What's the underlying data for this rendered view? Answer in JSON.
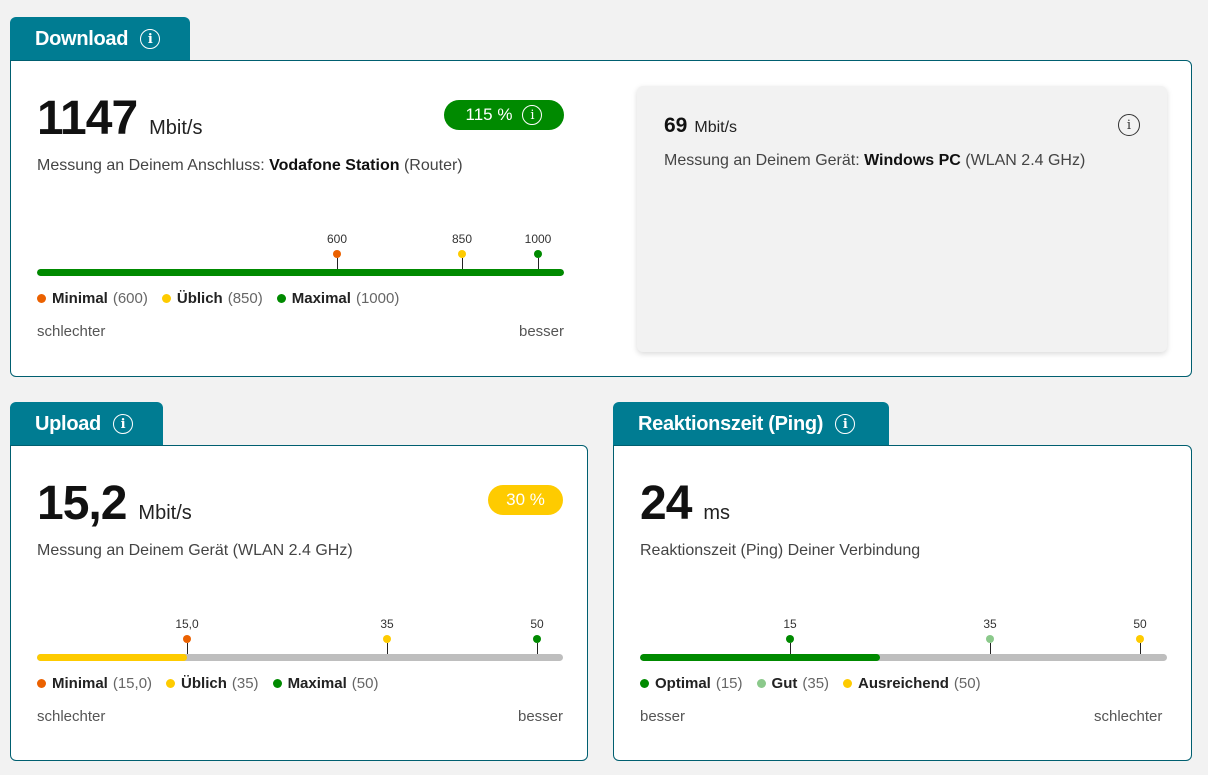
{
  "colors": {
    "orange": "#eb6100",
    "yellow": "#fecb00",
    "green": "#008a00",
    "lightgreen": "#8bc98b",
    "grey": "#bebebe",
    "teal": "#007c92"
  },
  "info_glyph": "i",
  "download": {
    "tab_label": "Download",
    "value": "1147",
    "unit": "Mbit/s",
    "badge": "115 %",
    "description_prefix": "Messung an Deinem Anschluss: ",
    "description_bold": "Vodafone Station",
    "description_suffix": " (Router)",
    "fill_fraction": 1.0,
    "ticks": [
      {
        "label": "600"
      },
      {
        "label": "850"
      },
      {
        "label": "1000"
      }
    ],
    "legend": [
      {
        "name": "Minimal",
        "value": "(600)"
      },
      {
        "name": "Üblich",
        "value": "(850)"
      },
      {
        "name": "Maximal",
        "value": "(1000)"
      }
    ],
    "scale_left": "schlechter",
    "scale_right": "besser",
    "device": {
      "value": "69",
      "unit": "Mbit/s",
      "description_prefix": "Messung an Deinem Gerät: ",
      "description_bold": "Windows PC",
      "description_suffix": " (WLAN 2.4 GHz)"
    }
  },
  "upload": {
    "tab_label": "Upload",
    "value": "15,2",
    "unit": "Mbit/s",
    "badge": "30 %",
    "description": "Messung an Deinem Gerät (WLAN 2.4 GHz)",
    "fill_fraction": 0.285,
    "ticks": [
      {
        "label": "15,0"
      },
      {
        "label": "35"
      },
      {
        "label": "50"
      }
    ],
    "legend": [
      {
        "name": "Minimal",
        "value": "(15,0)"
      },
      {
        "name": "Üblich",
        "value": "(35)"
      },
      {
        "name": "Maximal",
        "value": "(50)"
      }
    ],
    "scale_left": "schlechter",
    "scale_right": "besser"
  },
  "ping": {
    "tab_label": "Reaktionszeit (Ping)",
    "value": "24",
    "unit": "ms",
    "description": "Reaktionszeit (Ping) Deiner Verbindung",
    "fill_fraction": 0.455,
    "ticks": [
      {
        "label": "15"
      },
      {
        "label": "35"
      },
      {
        "label": "50"
      }
    ],
    "legend": [
      {
        "name": "Optimal",
        "value": "(15)"
      },
      {
        "name": "Gut",
        "value": "(35)"
      },
      {
        "name": "Ausreichend",
        "value": "(50)"
      }
    ],
    "scale_left": "besser",
    "scale_right": "schlechter"
  }
}
